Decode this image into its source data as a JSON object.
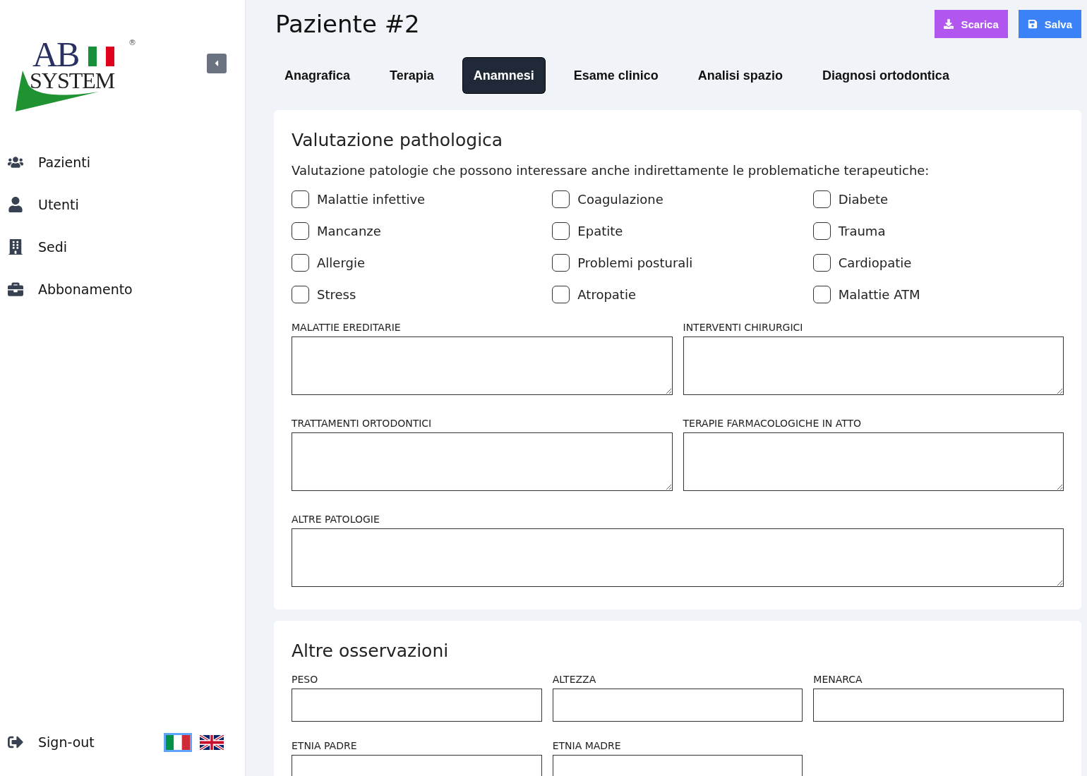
{
  "sidebar": {
    "logo": {
      "top": "AB",
      "bottom": "SYSTEM",
      "mark": "®"
    },
    "items": [
      {
        "label": "Pazienti"
      },
      {
        "label": "Utenti"
      },
      {
        "label": "Sedi"
      },
      {
        "label": "Abbonamento"
      }
    ],
    "signout": "Sign-out",
    "languages": [
      {
        "kind": "it",
        "selected": true
      },
      {
        "kind": "en",
        "selected": false
      }
    ]
  },
  "header": {
    "title": "Paziente #2",
    "buttons": [
      {
        "kind": "download",
        "label": "Scarica"
      },
      {
        "kind": "save",
        "label": "Salva"
      }
    ]
  },
  "tabs": [
    {
      "label": "Anagrafica",
      "selected": false
    },
    {
      "label": "Terapia",
      "selected": false
    },
    {
      "label": "Anamnesi",
      "selected": true
    },
    {
      "label": "Esame clinico",
      "selected": false
    },
    {
      "label": "Analisi spazio",
      "selected": false
    },
    {
      "label": "Diagnosi ortodontica",
      "selected": false
    }
  ],
  "pathology": {
    "title": "Valutazione pathologica",
    "description": "Valutazione patologie che possono interessare anche indirettamente le problematiche terapeutiche:",
    "checkboxes": [
      {
        "label": "Malattie infettive",
        "checked": false
      },
      {
        "label": "Coagulazione",
        "checked": false
      },
      {
        "label": "Diabete",
        "checked": false
      },
      {
        "label": "Mancanze",
        "checked": false
      },
      {
        "label": "Epatite",
        "checked": false
      },
      {
        "label": "Trauma",
        "checked": false
      },
      {
        "label": "Allergie",
        "checked": false
      },
      {
        "label": "Problemi posturali",
        "checked": false
      },
      {
        "label": "Cardiopatie",
        "checked": false
      },
      {
        "label": "Stress",
        "checked": false
      },
      {
        "label": "Atropatie",
        "checked": false
      },
      {
        "label": "Malattie ATM",
        "checked": false
      }
    ],
    "textareas": [
      {
        "label": "MALATTIE EREDITARIE"
      },
      {
        "label": "INTERVENTI CHIRURGICI"
      },
      {
        "label": "TRATTAMENTI ORTODONTICI"
      },
      {
        "label": "TERAPIE FARMACOLOGICHE IN ATTO"
      },
      {
        "label": "ALTRE PATOLOGIE"
      }
    ]
  },
  "observations": {
    "title": "Altre osservazioni",
    "fields": [
      {
        "label": "PESO"
      },
      {
        "label": "ALTEZZA"
      },
      {
        "label": "MENARCA"
      },
      {
        "label": "ETNIA PADRE"
      },
      {
        "label": "ETNIA MADRE"
      }
    ]
  }
}
